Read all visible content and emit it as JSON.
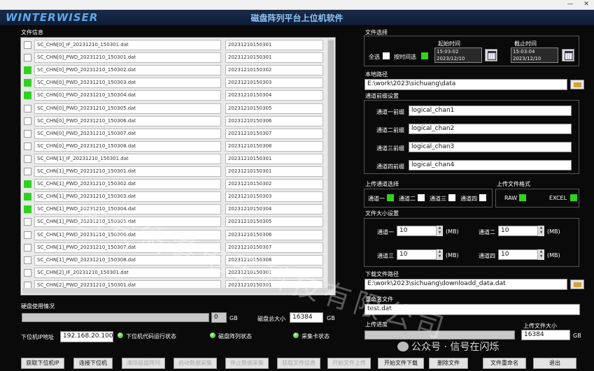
{
  "window": {
    "minimize": "—",
    "close": "✕"
  },
  "header": {
    "logo": "WINTERWISER",
    "title": "磁盘阵列平台上位机软件"
  },
  "file_info": {
    "title": "文件信息",
    "rows": [
      {
        "name": "SC_CHN[0]_IF_20231210_150301.dat",
        "ts": "20231210150301",
        "checked": false
      },
      {
        "name": "SC_CHN[0]_PWD_20231210_150301.dat",
        "ts": "20231210150301",
        "checked": false
      },
      {
        "name": "SC_CHN[0]_PWD_20231210_150302.dat",
        "ts": "20231210150302",
        "checked": true
      },
      {
        "name": "SC_CHN[0]_PWD_20231210_150303.dat",
        "ts": "20231210150303",
        "checked": true
      },
      {
        "name": "SC_CHN[0]_PWD_20231210_150304.dat",
        "ts": "20231210150304",
        "checked": true
      },
      {
        "name": "SC_CHN[0]_PWD_20231210_150305.dat",
        "ts": "20231210150305",
        "checked": false
      },
      {
        "name": "SC_CHN[0]_PWD_20231210_150306.dat",
        "ts": "20231210150306",
        "checked": false
      },
      {
        "name": "SC_CHN[0]_PWD_20231210_150307.dat",
        "ts": "20231210150307",
        "checked": false
      },
      {
        "name": "SC_CHN[0]_PWD_20231210_150308.dat",
        "ts": "20231210150308",
        "checked": false
      },
      {
        "name": "SC_CHN[1]_IF_20231210_150301.dat",
        "ts": "20231210150301",
        "checked": false
      },
      {
        "name": "SC_CHN[1]_PWD_20231210_150301.dat",
        "ts": "20231210150301",
        "checked": false
      },
      {
        "name": "SC_CHN[1]_PWD_20231210_150302.dat",
        "ts": "20231210150302",
        "checked": true
      },
      {
        "name": "SC_CHN[1]_PWD_20231210_150303.dat",
        "ts": "20231210150303",
        "checked": true
      },
      {
        "name": "SC_CHN[1]_PWD_20231210_150304.dat",
        "ts": "20231210150304",
        "checked": true
      },
      {
        "name": "SC_CHN[1]_PWD_20231210_150305.dat",
        "ts": "20231210150305",
        "checked": false
      },
      {
        "name": "SC_CHN[1]_PWD_20231210_150306.dat",
        "ts": "20231210150306",
        "checked": false
      },
      {
        "name": "SC_CHN[1]_PWD_20231210_150307.dat",
        "ts": "20231210150307",
        "checked": false
      },
      {
        "name": "SC_CHN[1]_PWD_20231210_150308.dat",
        "ts": "20231210150308",
        "checked": false
      },
      {
        "name": "SC_CHN[2]_IF_20231210_150301.dat",
        "ts": "20231210150301",
        "checked": false
      },
      {
        "name": "SC_CHN[2]_PWD_20231210_150301.dat",
        "ts": "20231210150301",
        "checked": false
      }
    ]
  },
  "disk": {
    "usage_label": "硬盘使用情况",
    "used": "0",
    "unit": "GB",
    "total_label": "磁盘总大小",
    "total": "16384",
    "total_unit": "GB"
  },
  "status": {
    "ip_label": "下位机IP地址",
    "ip": "192.168.20.100",
    "s1": "下位机代码运行状态",
    "s2": "磁盘阵列状态",
    "s3": "采集卡状态"
  },
  "file_select": {
    "title": "文件选择",
    "all": "全选",
    "all_checked": false,
    "by_time": "按时间选",
    "by_time_checked": true,
    "start_label": "起始时间",
    "start_time": "15:03:02",
    "start_date": "2023/12/10",
    "end_label": "截止时间",
    "end_time": "15:03:04",
    "end_date": "2023/12/10"
  },
  "local_path": {
    "label": "本地路径",
    "value": "E:\\work\\2023\\sichuang\\data"
  },
  "prefix": {
    "title": "通道前缀设置",
    "items": [
      {
        "label": "通道一前缀",
        "value": "logical_chan1"
      },
      {
        "label": "通道二前缀",
        "value": "logical_chan2"
      },
      {
        "label": "通道三前缀",
        "value": "logical_chan3"
      },
      {
        "label": "通道四前缀",
        "value": "logical_chan4"
      }
    ]
  },
  "upload_channel": {
    "title": "上传通道选择",
    "items": [
      {
        "label": "通道一",
        "on": true
      },
      {
        "label": "通道二",
        "on": false
      },
      {
        "label": "通道三",
        "on": false
      },
      {
        "label": "通道四",
        "on": false
      }
    ]
  },
  "upload_format": {
    "title": "上传文件格式",
    "raw": "RAW",
    "raw_on": true,
    "excel": "EXCEL",
    "excel_on": true
  },
  "file_size": {
    "title": "文件大小设置",
    "items": [
      {
        "label": "通道一",
        "value": "10",
        "unit": "(MB)"
      },
      {
        "label": "通道二",
        "value": "10",
        "unit": "(MB)"
      },
      {
        "label": "通道三",
        "value": "10",
        "unit": "(MB)"
      },
      {
        "label": "通道四",
        "value": "10",
        "unit": "(MB)"
      }
    ]
  },
  "download_path": {
    "label": "下载文件路径",
    "value": "E:\\work\\2023\\sichuang\\downloadd_data.dat"
  },
  "rename": {
    "label": "重命名文件",
    "value": "test.dat"
  },
  "upload_progress": {
    "label": "上传进度",
    "size_label": "上传文件大小",
    "size": "16384",
    "unit": "GB"
  },
  "buttons": [
    "获取下位机IP",
    "连接下位机",
    "清除磁盘阵列",
    "启动数据采集",
    "停止数据采集",
    "获取文件信息",
    "开始文件上传",
    "开始文件下载",
    "删除文件",
    "文件重命名",
    "退出"
  ],
  "watermark": "西安彼睿电子科技有限公司",
  "wechat": "公众号 · 信号在闪烁"
}
